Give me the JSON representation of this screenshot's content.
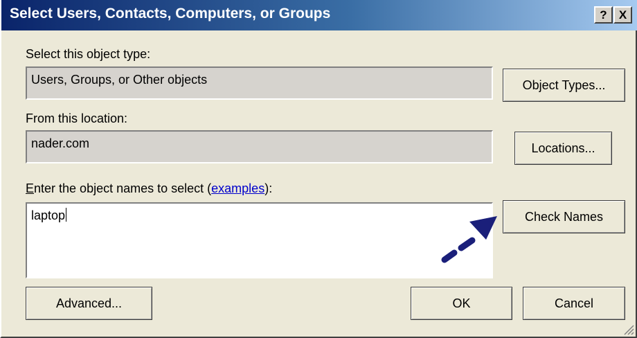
{
  "window": {
    "title": "Select Users, Contacts, Computers, or Groups",
    "help_button": "?",
    "close_button": "X"
  },
  "object_type": {
    "label": "Select this object type:",
    "value": "Users, Groups, or Other objects",
    "button": "Object Types..."
  },
  "location": {
    "label": "From this location:",
    "value": "nader.com",
    "button": "Locations..."
  },
  "names": {
    "label_prefix_underlined": "E",
    "label_rest": "nter the object names to select (",
    "examples_link": "examples",
    "label_suffix": "):",
    "value": "laptop"
  },
  "buttons": {
    "check_names": "Check Names",
    "advanced": "Advanced...",
    "ok": "OK",
    "cancel": "Cancel"
  },
  "annotation": {
    "arrow_color": "#1a1f7a",
    "points_to": "Check Names"
  },
  "colors": {
    "dialog_bg": "#ece9d8",
    "title_start": "#0a246a",
    "title_end": "#a6caf0",
    "link": "#0000cc"
  }
}
